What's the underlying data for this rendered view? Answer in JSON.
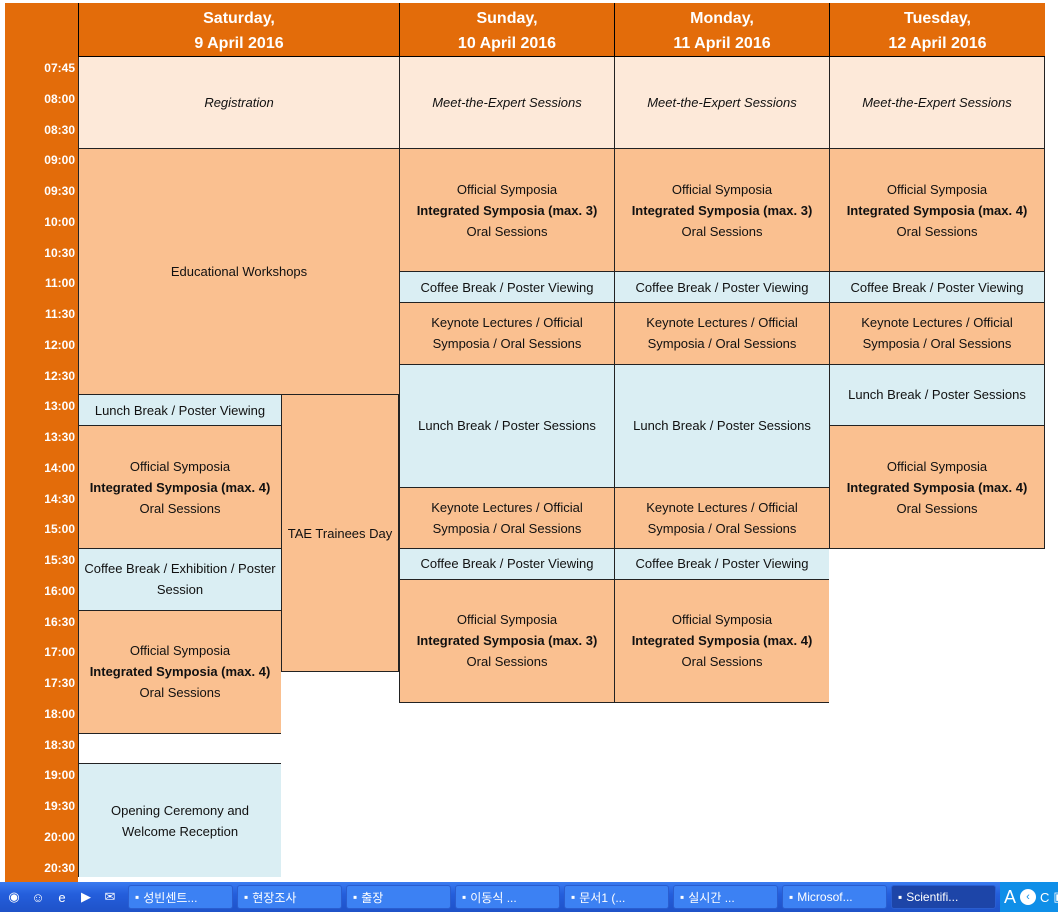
{
  "days": [
    {
      "line1": "Saturday,",
      "line2": "9 April 2016"
    },
    {
      "line1": "Sunday,",
      "line2": "10 April 2016"
    },
    {
      "line1": "Monday,",
      "line2": "11 April 2016"
    },
    {
      "line1": "Tuesday,",
      "line2": "12 April 2016"
    }
  ],
  "time_labels": [
    "07:45",
    "08:00",
    "08:30",
    "09:00",
    "09:30",
    "10:00",
    "10:30",
    "11:00",
    "11:30",
    "12:00",
    "12:30",
    "13:00",
    "13:30",
    "14:00",
    "14:30",
    "15:00",
    "15:30",
    "16:00",
    "16:30",
    "17:00",
    "17:30",
    "18:00",
    "18:30",
    "19:00",
    "19:30",
    "20:00",
    "20:30"
  ],
  "colors": {
    "header": "#E36C0A",
    "registration": "#FDE9D9",
    "session": "#FAC090",
    "break": "#DAEEF3"
  },
  "blocks": [
    {
      "col": "sat",
      "start": "07:30",
      "end": "09:00",
      "style": "peach",
      "lines": [
        "Registration"
      ]
    },
    {
      "col": "sat",
      "start": "09:00",
      "end": "13:00",
      "style": "org",
      "lines": [
        "Educational Workshops"
      ]
    },
    {
      "col": "satL",
      "start": "13:00",
      "end": "13:30",
      "style": "blue",
      "lines": [
        "Lunch Break / Poster Viewing"
      ]
    },
    {
      "col": "satL",
      "start": "13:30",
      "end": "15:30",
      "style": "org",
      "lines": [
        "Official Symposia",
        "Integrated Symposia (max. 4)",
        "Oral Sessions"
      ]
    },
    {
      "col": "satL",
      "start": "15:30",
      "end": "16:30",
      "style": "blue",
      "lines": [
        "Coffee Break / Exhibition / Poster Session"
      ]
    },
    {
      "col": "satL",
      "start": "16:30",
      "end": "18:30",
      "style": "org",
      "lines": [
        "Official Symposia",
        "Integrated Symposia (max. 4)",
        "Oral Sessions"
      ]
    },
    {
      "col": "satL",
      "start": "18:30",
      "end": "19:00",
      "style": "white",
      "lines": []
    },
    {
      "col": "satL",
      "start": "19:00",
      "end": "20:50",
      "style": "blue",
      "lines": [
        "Opening Ceremony and Welcome Reception"
      ]
    },
    {
      "col": "satR",
      "start": "13:00",
      "end": "17:30",
      "style": "org",
      "lines": [
        "TAE Trainees Day"
      ]
    },
    {
      "col": "sun",
      "start": "07:30",
      "end": "09:00",
      "style": "peach",
      "lines": [
        "Meet-the-Expert Sessions"
      ]
    },
    {
      "col": "sun",
      "start": "09:00",
      "end": "11:00",
      "style": "org",
      "lines": [
        "Official Symposia",
        "Integrated Symposia (max. 3)",
        "Oral Sessions"
      ]
    },
    {
      "col": "sun",
      "start": "11:00",
      "end": "11:30",
      "style": "blue",
      "lines": [
        "Coffee Break / Poster Viewing"
      ]
    },
    {
      "col": "sun",
      "start": "11:30",
      "end": "12:30",
      "style": "org",
      "lines": [
        "Keynote Lectures / Official Symposia / Oral Sessions"
      ]
    },
    {
      "col": "sun",
      "start": "12:30",
      "end": "14:30",
      "style": "blue",
      "lines": [
        "Lunch Break / Poster Sessions"
      ]
    },
    {
      "col": "sun",
      "start": "14:30",
      "end": "15:30",
      "style": "org",
      "lines": [
        "Keynote Lectures / Official Symposia / Oral Sessions"
      ]
    },
    {
      "col": "sun",
      "start": "15:30",
      "end": "16:00",
      "style": "blue",
      "lines": [
        "Coffee Break / Poster Viewing"
      ]
    },
    {
      "col": "sun",
      "start": "16:00",
      "end": "18:00",
      "style": "org",
      "lines": [
        "Official Symposia",
        "Integrated Symposia (max. 3)",
        "Oral Sessions"
      ]
    },
    {
      "col": "mon",
      "start": "07:30",
      "end": "09:00",
      "style": "peach",
      "lines": [
        "Meet-the-Expert Sessions"
      ]
    },
    {
      "col": "mon",
      "start": "09:00",
      "end": "11:00",
      "style": "org",
      "lines": [
        "Official Symposia",
        "Integrated Symposia (max. 3)",
        "Oral Sessions"
      ]
    },
    {
      "col": "mon",
      "start": "11:00",
      "end": "11:30",
      "style": "blue",
      "lines": [
        "Coffee Break / Poster Viewing"
      ]
    },
    {
      "col": "mon",
      "start": "11:30",
      "end": "12:30",
      "style": "org",
      "lines": [
        "Keynote Lectures / Official Symposia / Oral Sessions"
      ]
    },
    {
      "col": "mon",
      "start": "12:30",
      "end": "14:30",
      "style": "blue",
      "lines": [
        "Lunch Break / Poster Sessions"
      ]
    },
    {
      "col": "mon",
      "start": "14:30",
      "end": "15:30",
      "style": "org",
      "lines": [
        "Keynote Lectures / Official Symposia / Oral Sessions"
      ]
    },
    {
      "col": "mon",
      "start": "15:30",
      "end": "16:00",
      "style": "blue",
      "lines": [
        "Coffee Break / Poster Viewing"
      ]
    },
    {
      "col": "mon",
      "start": "16:00",
      "end": "18:00",
      "style": "org",
      "lines": [
        "Official Symposia",
        "Integrated Symposia (max. 4)",
        "Oral Sessions"
      ]
    },
    {
      "col": "tue",
      "start": "07:30",
      "end": "09:00",
      "style": "peach",
      "lines": [
        "Meet-the-Expert Sessions"
      ]
    },
    {
      "col": "tue",
      "start": "09:00",
      "end": "11:00",
      "style": "org",
      "lines": [
        "Official Symposia",
        "Integrated Symposia (max. 4)",
        "Oral Sessions"
      ]
    },
    {
      "col": "tue",
      "start": "11:00",
      "end": "11:30",
      "style": "blue",
      "lines": [
        "Coffee Break / Poster Viewing"
      ]
    },
    {
      "col": "tue",
      "start": "11:30",
      "end": "12:30",
      "style": "org",
      "lines": [
        "Keynote Lectures / Official Symposia / Oral Sessions"
      ]
    },
    {
      "col": "tue",
      "start": "12:30",
      "end": "13:30",
      "style": "blue",
      "lines": [
        "Lunch Break  / Poster Sessions"
      ]
    },
    {
      "col": "tue",
      "start": "13:30",
      "end": "15:30",
      "style": "org",
      "lines": [
        "Official Symposia",
        "Integrated Symposia (max. 4)",
        "Oral Sessions"
      ]
    }
  ],
  "taskbar": {
    "quick_launch": [
      "chrome-icon",
      "user-icon",
      "ie-icon",
      "media-player-icon",
      "outlook-icon"
    ],
    "items": [
      "성빈센트...",
      "현장조사",
      "출장",
      "이동식 ...",
      "문서1 (...",
      "실시간 ...",
      "Microsof...",
      "Scientifi..."
    ],
    "active": 7,
    "tray_text": "A"
  }
}
